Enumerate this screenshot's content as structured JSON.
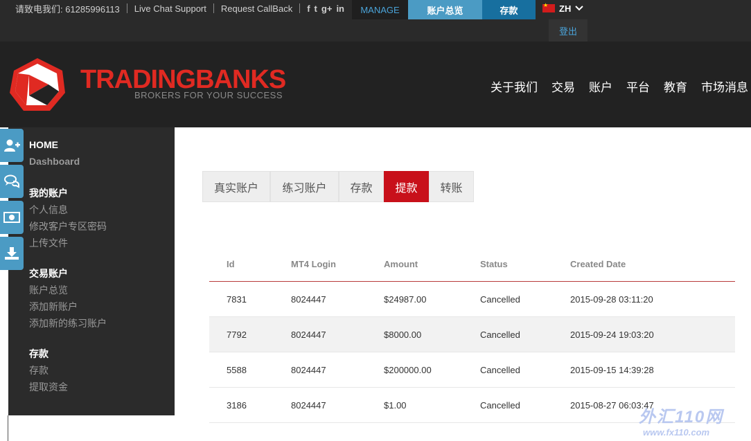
{
  "topbar": {
    "phone": "请致电我们: 61285996113",
    "live_chat": "Live Chat Support",
    "callback": "Request CallBack",
    "social": [
      "f",
      "t",
      "g+",
      "in"
    ],
    "manage": "MANAGE",
    "overview": "账户总览",
    "deposit": "存款",
    "lang": "ZH",
    "logout": "登出"
  },
  "header": {
    "brand_red": "TRADINGBANKS",
    "tagline": "BROKERS FOR YOUR SUCCESS",
    "nav": [
      "关于我们",
      "交易",
      "账户",
      "平台",
      "教育",
      "市场消息"
    ]
  },
  "sidebar": {
    "home": "HOME",
    "dashboard": "Dashboard",
    "my_account": "我的账户",
    "personal_info": "个人信息",
    "change_password": "修改客户专区密码",
    "upload_files": "上传文件",
    "trading_account": "交易账户",
    "account_overview": "账户总览",
    "add_account": "添加新账户",
    "add_demo_account": "添加新的练习账户",
    "deposit_head": "存款",
    "deposit": "存款",
    "withdraw_funds": "提取资金"
  },
  "tabs": [
    "真实账户",
    "练习账户",
    "存款",
    "提款",
    "转账"
  ],
  "table": {
    "headers": [
      "Id",
      "MT4 Login",
      "Amount",
      "Status",
      "Created Date"
    ],
    "rows": [
      [
        "7831",
        "8024447",
        "$24987.00",
        "Cancelled",
        "2015-09-28 03:11:20"
      ],
      [
        "7792",
        "8024447",
        "$8000.00",
        "Cancelled",
        "2015-09-24 19:03:20"
      ],
      [
        "5588",
        "8024447",
        "$200000.00",
        "Cancelled",
        "2015-09-15 14:39:28"
      ],
      [
        "3186",
        "8024447",
        "$1.00",
        "Cancelled",
        "2015-08-27 06:03:47"
      ]
    ]
  },
  "watermark": {
    "line1": "外汇110网",
    "line2": "www.fx110.com"
  }
}
